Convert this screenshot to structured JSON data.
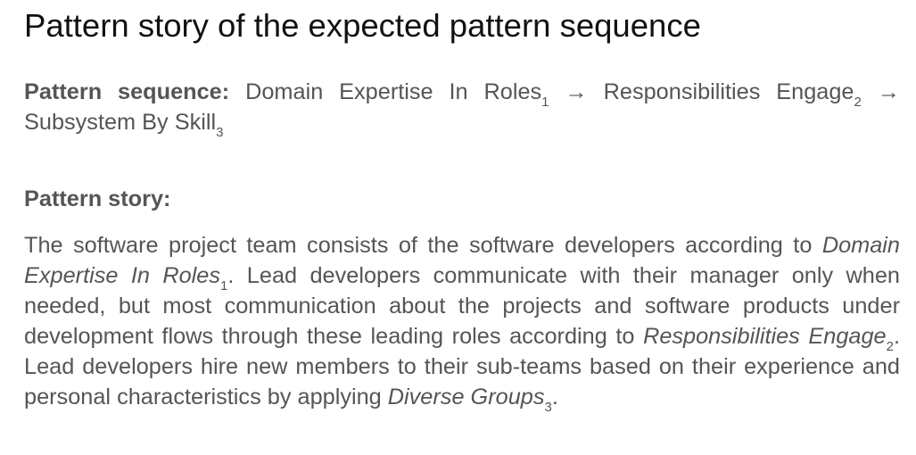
{
  "title": "Pattern story of the expected pattern sequence",
  "sequence": {
    "label": "Pattern sequence:",
    "items": [
      {
        "name": "Domain Expertise In Roles",
        "index": "1"
      },
      {
        "name": "Responsibilities Engage",
        "index": "2"
      },
      {
        "name": "Subsystem By Skill",
        "index": "3"
      }
    ],
    "arrow": "→"
  },
  "story": {
    "label": "Pattern story:",
    "t1": "The software project team consists of the software developers according to ",
    "ref1": {
      "name": "Domain Expertise In Roles",
      "index": "1"
    },
    "t2": ". Lead developers communicate with their manager only when needed, but most communication about the projects and software products under development flows through these leading roles according to ",
    "ref2": {
      "name": "Responsibilities Engage",
      "index": "2"
    },
    "t3": ". Lead developers hire new members to their sub-teams based on their experience and personal characteristics by applying ",
    "ref3": {
      "name": "Diverse Groups",
      "index": "3"
    },
    "t4": "."
  }
}
